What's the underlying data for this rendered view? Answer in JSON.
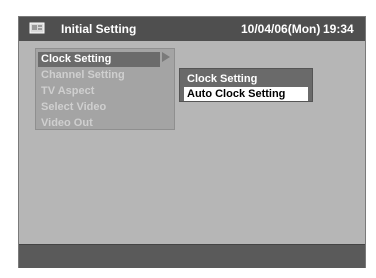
{
  "header": {
    "icon": "setup-icon",
    "title": "Initial Setting",
    "date": "10/04/06(Mon)",
    "time": "19:34"
  },
  "menu": {
    "items": [
      {
        "label": "Clock Setting"
      },
      {
        "label": "Channel Setting"
      },
      {
        "label": "TV Aspect"
      },
      {
        "label": "Select Video"
      },
      {
        "label": "Video Out"
      }
    ]
  },
  "submenu": {
    "items": [
      {
        "label": "Clock Setting"
      },
      {
        "label": "Auto Clock Setting"
      }
    ]
  },
  "colors": {
    "background": "#b6b6b6",
    "titlebar": "#4f4f4f",
    "selected": "#6b6b6b",
    "highlight": "#ffffff"
  }
}
